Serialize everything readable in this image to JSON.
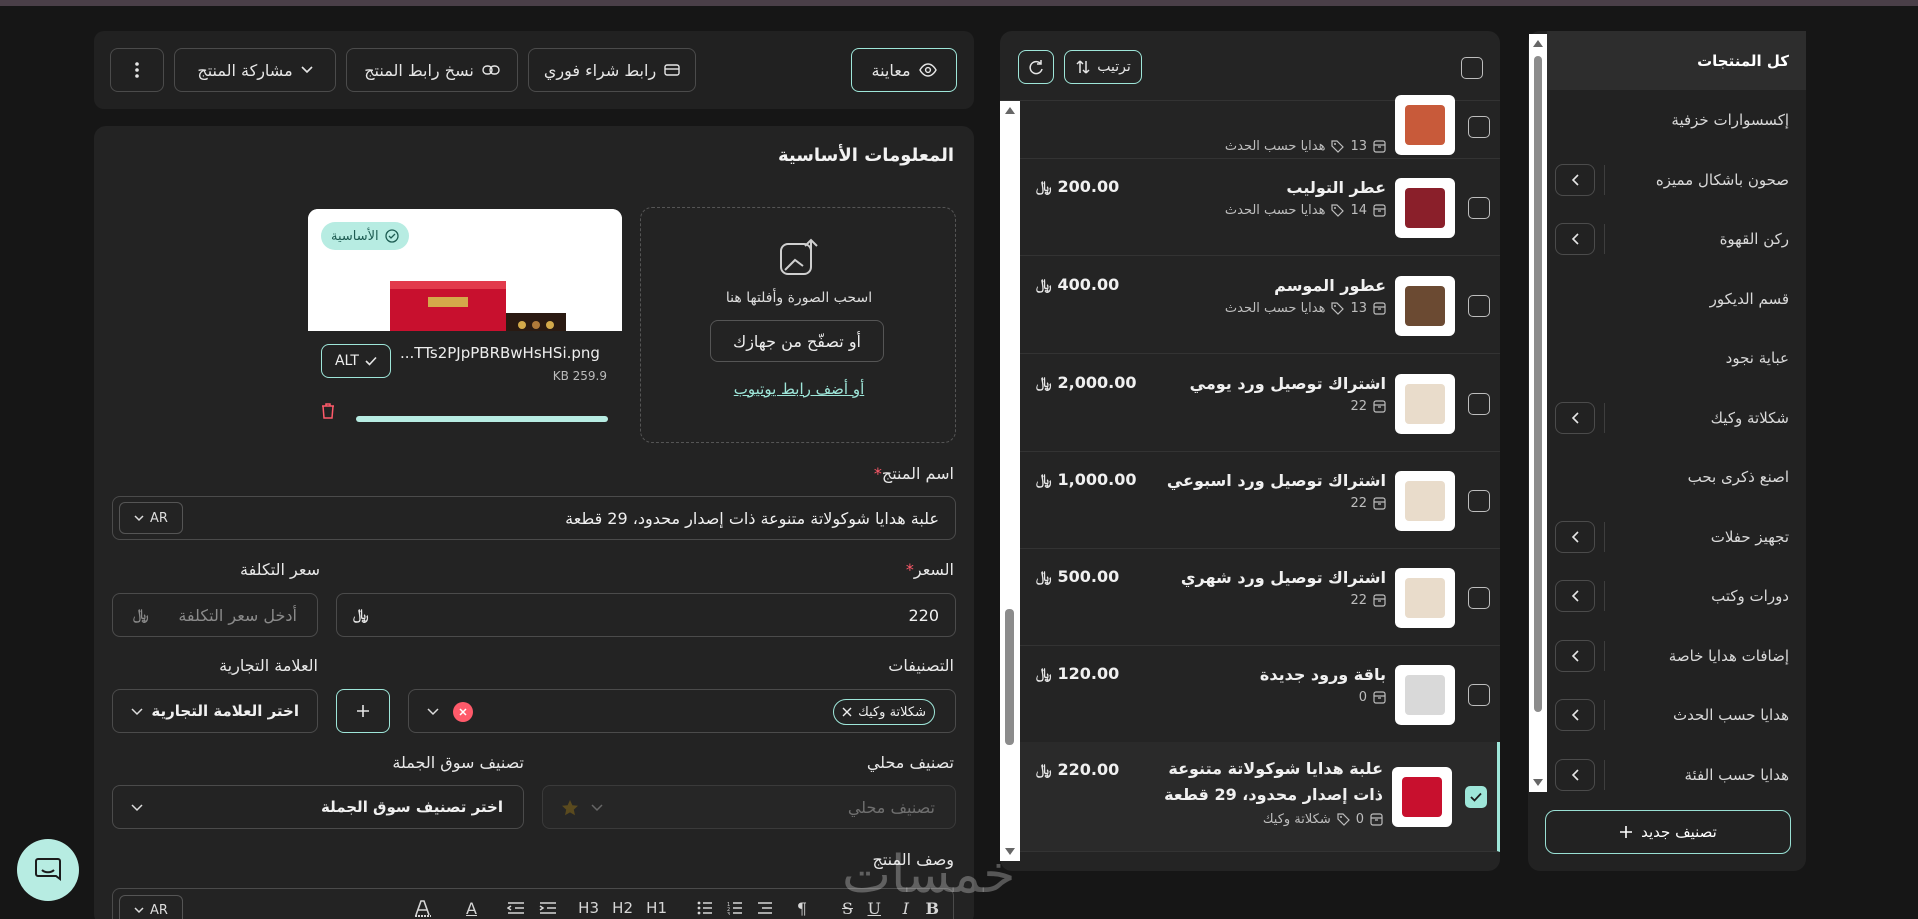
{
  "categories": {
    "items": [
      {
        "label": "كل المنتجات",
        "active": true,
        "expandable": false
      },
      {
        "label": "إكسسوارات خزفية",
        "expandable": false
      },
      {
        "label": "صحون باشكال مميزه",
        "expandable": true
      },
      {
        "label": "ركن القهوة",
        "expandable": true
      },
      {
        "label": "قسم الديكور",
        "expandable": false
      },
      {
        "label": "عباية نجود",
        "expandable": false
      },
      {
        "label": "شكلاتة وكيك",
        "expandable": true
      },
      {
        "label": "اصنع ذكرى بحب",
        "expandable": false
      },
      {
        "label": "تجهيز حفلات",
        "expandable": true
      },
      {
        "label": "دورات وكتب",
        "expandable": true
      },
      {
        "label": "إضافات هدايا خاصة",
        "expandable": true
      },
      {
        "label": "هدايا حسب الحدث",
        "expandable": true
      },
      {
        "label": "هدايا حسب الفئة",
        "expandable": true
      }
    ],
    "new_label": "تصنيف جديد"
  },
  "products": {
    "sort_label": "ترتيب",
    "currency": "﷼",
    "rows": [
      {
        "name": "",
        "price": "",
        "qty": "13",
        "cat": "هدايا حسب الحدث",
        "thumb": "#c85a3a",
        "checked": false
      },
      {
        "name": "عطر التوليب",
        "price": "200.00",
        "qty": "14",
        "cat": "هدايا حسب الحدث",
        "thumb": "#8a1f2a",
        "checked": false
      },
      {
        "name": "عطور الموسم",
        "price": "400.00",
        "qty": "13",
        "cat": "هدايا حسب الحدث",
        "thumb": "#6b4a32",
        "checked": false
      },
      {
        "name": "اشتراك توصيل ورد يومي",
        "price": "2,000.00",
        "qty": "22",
        "cat": "",
        "thumb": "#e9dccb",
        "checked": false
      },
      {
        "name": "اشتراك توصيل ورد اسبوعي",
        "price": "1,000.00",
        "qty": "22",
        "cat": "",
        "thumb": "#e9dccb",
        "checked": false
      },
      {
        "name": "اشتراك توصيل ورد شهري",
        "price": "500.00",
        "qty": "22",
        "cat": "",
        "thumb": "#e9dccb",
        "checked": false
      },
      {
        "name": "باقة ورود جديدة",
        "price": "120.00",
        "qty": "0",
        "cat": "",
        "thumb": "#d9d9d9",
        "checked": false
      },
      {
        "name": "علبة هدايا شوكولاتة متنوعة ذات إصدار محدود، 29 قطعة",
        "price": "220.00",
        "qty": "0",
        "cat": "شكلاتة وكيك",
        "thumb": "#c8102e",
        "checked": true
      }
    ]
  },
  "actions": {
    "preview": "معاينة",
    "buy_link": "رابط شراء فوري",
    "copy_link": "نسخ رابط المنتج",
    "share": "مشاركة المنتج"
  },
  "editor": {
    "section_title": "المعلومات الأساسية",
    "dropzone": {
      "drag_text": "اسحب الصورة وأفلتها هنا",
      "browse": "أو تصفّح من جهازك",
      "youtube": "أو أضف رابط يوتيوب"
    },
    "image": {
      "badge": "الأساسية",
      "file_name": "...TTs2PJpPBRBwHsHSi.png",
      "file_size": "KB 259.9",
      "alt": "ALT",
      "upload_progress": 1.0
    },
    "name_label": "اسم المنتج",
    "name_value": "علبة هدايا شوكولاتة متنوعة ذات إصدار محدود، 29 قطعة",
    "lang": "AR",
    "price_label": "السعر",
    "price_value": "220",
    "cost_label": "سعر التكلفة",
    "cost_placeholder": "أدخل سعر التكلفة",
    "categories_label": "التصنيفات",
    "category_chip": "شكلاتة وكيك",
    "brand_label": "العلامة التجارية",
    "brand_value": "اختر العلامة التجارية",
    "local_label": "تصنيف محلي",
    "local_placeholder": "تصنيف محلي",
    "wholesale_label": "تصنيف سوق الجملة",
    "wholesale_value": "اختر تصنيف سوق الجملة",
    "desc_label": "وصف المنتج",
    "rte": [
      "B",
      "I",
      "U",
      "S",
      "¶",
      "H1",
      "H2",
      "H3",
      "A"
    ]
  },
  "watermark": "خمسات",
  "colors": {
    "accent": "#9ee6d9",
    "danger": "#ff5a6a",
    "panel": "#232323"
  }
}
